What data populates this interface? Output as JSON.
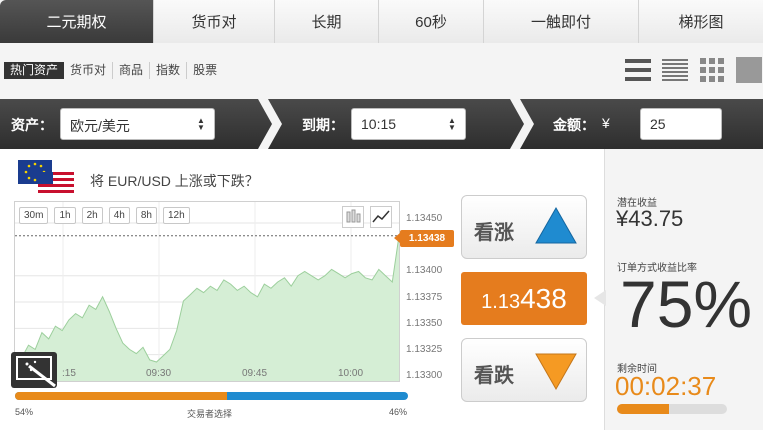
{
  "tabs": [
    "二元期权",
    "货币对",
    "长期",
    "60秒",
    "一触即付",
    "梯形图"
  ],
  "categories": [
    "热门资产",
    "货币对",
    "商品",
    "指数",
    "股票"
  ],
  "view_icons": [
    "list-large-icon",
    "list-compact-icon",
    "grid-small-icon",
    "grid-large-icon"
  ],
  "bar": {
    "asset_label": "资产：",
    "asset_value": "欧元/美元",
    "expiry_label": "到期：",
    "expiry_value": "10:15",
    "amount_label": "金额：",
    "currency": "¥",
    "amount_value": "25"
  },
  "question": "将 EUR/USD 上涨或下跌？",
  "ranges": [
    "30m",
    "1h",
    "2h",
    "4h",
    "8h",
    "12h"
  ],
  "y_ticks": [
    "1.13450",
    "1.13400",
    "1.13375",
    "1.13350",
    "1.13325",
    "1.13300"
  ],
  "x_ticks": [
    ":15",
    "09:30",
    "09:45",
    "10:00"
  ],
  "current_price_tag": "1.13438",
  "current_price": {
    "lead": "1.13",
    "tail": "438"
  },
  "call_label": "看涨",
  "put_label": "看跌",
  "sentiment": {
    "left_pct": "54%",
    "right_pct": "46%",
    "label": "交易者选择",
    "call_fraction": 0.54
  },
  "right_panel": {
    "potential_label": "潜在收益",
    "potential_value": "¥43.75",
    "payout_label": "订单方式收益比率",
    "payout_pct": "75%",
    "remaining_label": "剩余时间",
    "remaining_value": "00:02:37",
    "remaining_fraction": 0.47
  },
  "colors": {
    "accent": "#e57c1e",
    "call": "#1f8bd0",
    "dark": "#333333"
  },
  "chart_data": {
    "type": "area",
    "series": [
      {
        "values": [
          1.13318,
          1.13322,
          1.13334,
          1.1333,
          1.13346,
          1.1334,
          1.13352,
          1.13348,
          1.13358,
          1.13364,
          1.1336,
          1.13372,
          1.13368,
          1.1338,
          1.13366,
          1.1335,
          1.13336,
          1.1333,
          1.13326,
          1.13332,
          1.1332,
          1.13318,
          1.13324,
          1.1333,
          1.13348,
          1.13376,
          1.13382,
          1.13388,
          1.13384,
          1.1339,
          1.13386,
          1.13396,
          1.13392,
          1.13386,
          1.1339,
          1.13384,
          1.1338,
          1.13392,
          1.13388,
          1.13394,
          1.13398,
          1.1339,
          1.134,
          1.13404,
          1.134,
          1.13396,
          1.134,
          1.13406,
          1.13402,
          1.13398,
          1.13402,
          1.13404,
          1.13398,
          1.13396,
          1.13406,
          1.134,
          1.13394,
          1.13438
        ]
      }
    ],
    "ylim": [
      1.133,
      1.1347
    ],
    "reference_line": 1.13438
  }
}
